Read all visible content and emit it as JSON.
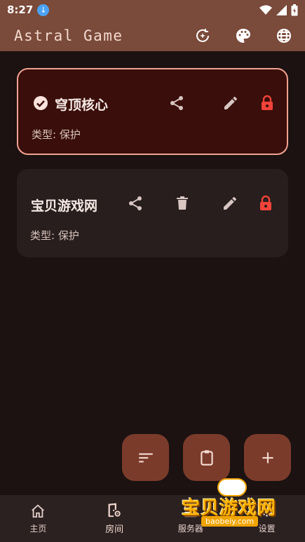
{
  "status_bar": {
    "time": "8:27"
  },
  "app_bar": {
    "title": "Astral Game"
  },
  "rooms": [
    {
      "name": "穹顶核心",
      "type_label": "类型: 保护",
      "selected": true
    },
    {
      "name": "宝贝游戏网",
      "type_label": "类型: 保护",
      "selected": false
    }
  ],
  "bottom_nav": [
    {
      "label": "主页"
    },
    {
      "label": "房间"
    },
    {
      "label": "服务器"
    },
    {
      "label": "设置"
    }
  ],
  "watermark": {
    "text": "宝贝游戏网",
    "url": "baobeiy.com"
  },
  "colors": {
    "app_bar": "#7a4a3a",
    "background": "#1b1211",
    "selected_card": "#3a0e0a",
    "selected_border": "#f2a392",
    "card": "#271e1d",
    "lock": "#f0433a",
    "fab": "#7b3b2b"
  }
}
